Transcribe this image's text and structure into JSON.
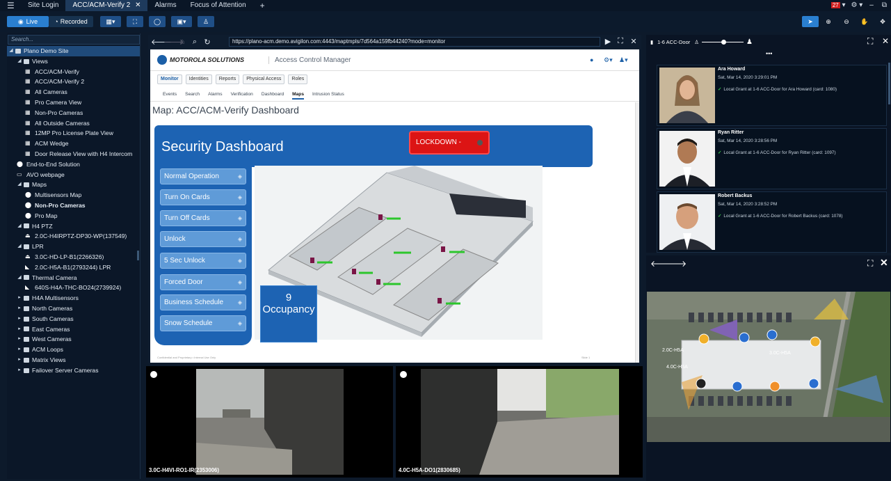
{
  "tabs": [
    "Site Login",
    "ACC/ACM-Verify 2",
    "Alarms",
    "Focus of Attention"
  ],
  "tab_close": "✕",
  "add_tab": "+",
  "notification_count": "27",
  "window_controls": [
    "–",
    "⧉"
  ],
  "toolbar": {
    "live": "Live",
    "recorded": "Recorded"
  },
  "tree": {
    "search_placeholder": "Search...",
    "items": [
      {
        "label": "Plano Demo Site",
        "level": 0,
        "kind": "arrow-down",
        "selected": true
      },
      {
        "label": "Views",
        "level": 1,
        "kind": "arrow-down"
      },
      {
        "label": "ACC/ACM-Verify",
        "level": 2,
        "kind": "view"
      },
      {
        "label": "ACC/ACM-Verify 2",
        "level": 2,
        "kind": "view"
      },
      {
        "label": "All Cameras",
        "level": 2,
        "kind": "view"
      },
      {
        "label": "Pro Camera View",
        "level": 2,
        "kind": "view"
      },
      {
        "label": "Non-Pro Cameras",
        "level": 2,
        "kind": "view"
      },
      {
        "label": "All Outside Cameras",
        "level": 2,
        "kind": "view"
      },
      {
        "label": "12MP Pro License Plate View",
        "level": 2,
        "kind": "view"
      },
      {
        "label": "ACM Wedge",
        "level": 2,
        "kind": "view"
      },
      {
        "label": "Door Release View with H4 Intercom",
        "level": 2,
        "kind": "view"
      },
      {
        "label": "End-to-End Solution",
        "level": 1,
        "kind": "pin"
      },
      {
        "label": "AVO webpage",
        "level": 1,
        "kind": "web"
      },
      {
        "label": "Maps",
        "level": 1,
        "kind": "arrow-down"
      },
      {
        "label": "Multisensors Map",
        "level": 2,
        "kind": "pin"
      },
      {
        "label": "Non-Pro Cameras",
        "level": 2,
        "kind": "pin",
        "bold": true
      },
      {
        "label": "Pro Map",
        "level": 2,
        "kind": "pin"
      },
      {
        "label": "H4 PTZ",
        "level": 1,
        "kind": "arrow-down"
      },
      {
        "label": "2.0C-H4IRPTZ-DP30-WP(137549)",
        "level": 2,
        "kind": "ptz"
      },
      {
        "label": "LPR",
        "level": 1,
        "kind": "arrow-down"
      },
      {
        "label": "3.0C-HD-LP-B1(2266326)",
        "level": 2,
        "kind": "ptz"
      },
      {
        "label": "2.0C-H5A-B1(2793244) LPR",
        "level": 2,
        "kind": "cam"
      },
      {
        "label": "Thermal Camera",
        "level": 1,
        "kind": "arrow-down"
      },
      {
        "label": "640S-H4A-THC-BO24(2739924)",
        "level": 2,
        "kind": "cam"
      },
      {
        "label": "H4A Multisensors",
        "level": 1,
        "kind": "arrow-right"
      },
      {
        "label": "North Cameras",
        "level": 1,
        "kind": "arrow-right"
      },
      {
        "label": "South Cameras",
        "level": 1,
        "kind": "arrow-right"
      },
      {
        "label": "East Cameras",
        "level": 1,
        "kind": "arrow-right"
      },
      {
        "label": "West Cameras",
        "level": 1,
        "kind": "arrow-right"
      },
      {
        "label": "ACM Loops",
        "level": 1,
        "kind": "arrow-right"
      },
      {
        "label": "Matrix Views",
        "level": 1,
        "kind": "arrow-right"
      },
      {
        "label": "Failover Server Cameras",
        "level": 1,
        "kind": "arrow-right"
      }
    ]
  },
  "browser": {
    "url": "https://plano-acm.demo.avigilon.com:4443/maptmpls/7d564a159fb44240?mode=monitor",
    "brand": "MOTOROLA SOLUTIONS",
    "app": "Access Control Manager",
    "menus": [
      "Monitor",
      "Identities",
      "Reports",
      "Physical Access",
      "Roles"
    ],
    "subtabs": [
      "Events",
      "Search",
      "Alarms",
      "Verification",
      "Dashboard",
      "Maps",
      "Intrusion Status"
    ],
    "active_subtab": "Maps",
    "map_title": "Map: ACC/ACM-Verify Dashboard",
    "dashboard_title": "Security Dashboard",
    "lockdown": "LOCKDOWN -",
    "buttons": [
      "Normal Operation",
      "Turn On Cards",
      "Turn Off Cards",
      "Unlock",
      "5 Sec Unlock",
      "Forced Door",
      "Business Schedule",
      "Snow Schedule"
    ],
    "occupancy_count": "9",
    "occupancy_label": "Occupancy",
    "footnote": "Confidential and Proprietary • Internal Use Only",
    "page_no": "Slide 1"
  },
  "events": {
    "header": "1-6 ACC-Door",
    "more": "•••",
    "cards": [
      {
        "name": "Ara Howard",
        "time": "Sat, Mar 14, 2020 3:29:01 PM",
        "grant": "Local Grant at 1-6 ACC-Door for Ara Howard (card: 1080)"
      },
      {
        "name": "Ryan Ritter",
        "time": "Sat, Mar 14, 2020 3:28:56 PM",
        "grant": "Local Grant at 1-6 ACC-Door for Ryan Ritter (card: 1097)"
      },
      {
        "name": "Robert Backus",
        "time": "Sat, Mar 14, 2020 3:28:52 PM",
        "grant": "Local Grant at 1-6 ACC-Door for Robert Backus (card: 1078)"
      }
    ]
  },
  "cameras": [
    {
      "label": "3.0C-H4VI-RO1-IR(2353006)"
    },
    {
      "label": "4.0C-H5A-DO1(2830685)"
    }
  ],
  "map_labels": [
    "2.0C-H5A",
    "4.0C-H5A",
    "3.0C-H5A"
  ],
  "colors": {
    "accent": "#2a7fd0",
    "panel": "#0d1a2b",
    "dashboard_blue": "#1d63b3",
    "lockdown_red": "#dc1414",
    "grant_green": "#36c24a"
  }
}
